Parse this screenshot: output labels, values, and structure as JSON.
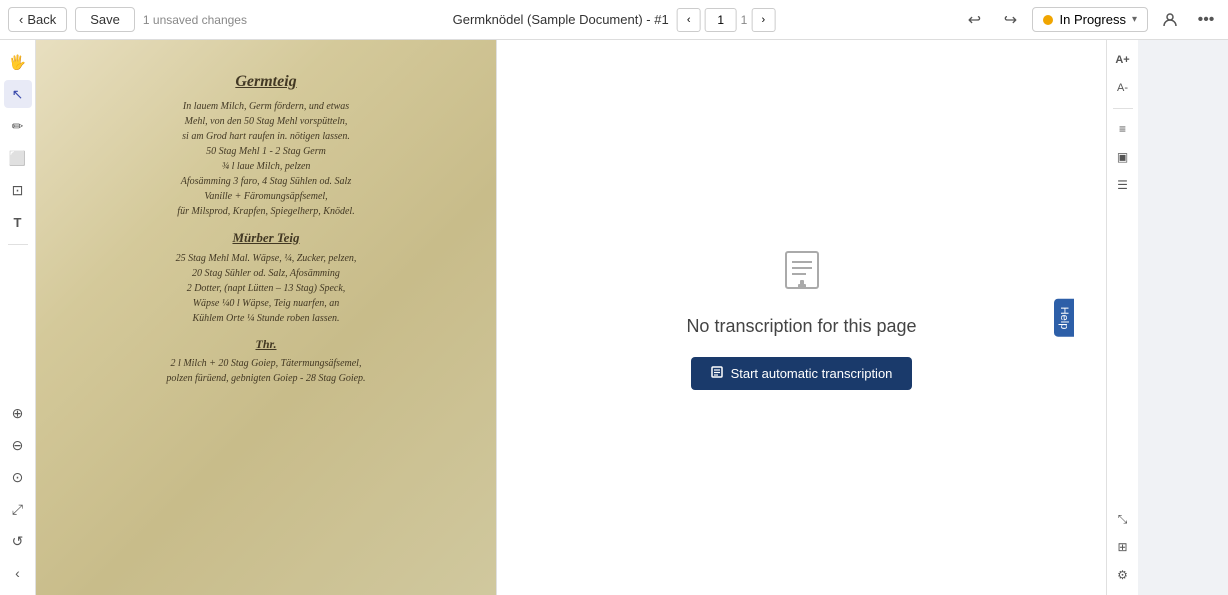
{
  "topbar": {
    "back_label": "Back",
    "save_label": "Save",
    "unsaved_changes": "1 unsaved changes",
    "document_title": "Germknödel (Sample Document) - #1",
    "page_current": "1",
    "page_total": "1",
    "undo_symbol": "↩",
    "redo_symbol": "↪",
    "status_label": "In Progress",
    "more_icon": "···"
  },
  "tools": {
    "hand_icon": "✋",
    "cursor_icon": "▲",
    "pen_icon": "✏",
    "rect_icon": "⬜",
    "crop_icon": "⊡",
    "text_icon": "T"
  },
  "bottom_tools": {
    "zoom_in_icon": "+",
    "zoom_out_icon": "−",
    "fit_icon": "⊙",
    "expand_icon": "⤢",
    "rotate_icon": "↺",
    "chevron_down": "‹"
  },
  "right_panel": {
    "no_transcription_text": "No transcription for this page",
    "start_btn_label": "Start automatic transcription"
  },
  "right_tools": {
    "font_increase": "A+",
    "font_decrease": "A-",
    "align_icon": "≡",
    "panel_icon": "▣",
    "list_icon": "☰"
  },
  "right_bottom_tools": {
    "expand_icon": "⤡",
    "grid_icon": "⊞",
    "settings_icon": "⚙"
  },
  "manuscript": {
    "heading": "Germteig",
    "lines1": [
      "In lauem Milch, Germ fördern, und etwas",
      "Mehl, von den 50 Stag Mehl vorspütteln,",
      "si am Grod hart raufen in. nötigen lassen.",
      "50 Stag Mehl 1 - 2 Stag Germ",
      "¾ l laue Milch, pelzen",
      "Afosämming 3 faro, 4 Stag Sühlen od. Salz",
      "Vanille + Färomungsäpfsemel,",
      "für Milsprod, Krapfen, Spiegelherp, Knödel."
    ],
    "subheading1": "Mürber Teig",
    "lines2": [
      "25 Stag Mehl Mal. Wäpse, ¼, Zucker, pelzen,",
      "20 Stag Sühler od. Salz, Afosämming",
      "2 Dotter, (napt Lütten – 13 Stag) Speck,",
      "Wäpse ¼0 l Wäpse, Teig nuarfen, an",
      "Kühlem Orte ¼ Stunde roben lassen."
    ],
    "subheading2": "Thr.",
    "lines3": [
      "2 l Milch + 20 Stag Goiep, Tätermungsäfsemel,",
      "polzen fürüend, gebnigten Goiep - 28 Stag Goiep."
    ]
  }
}
